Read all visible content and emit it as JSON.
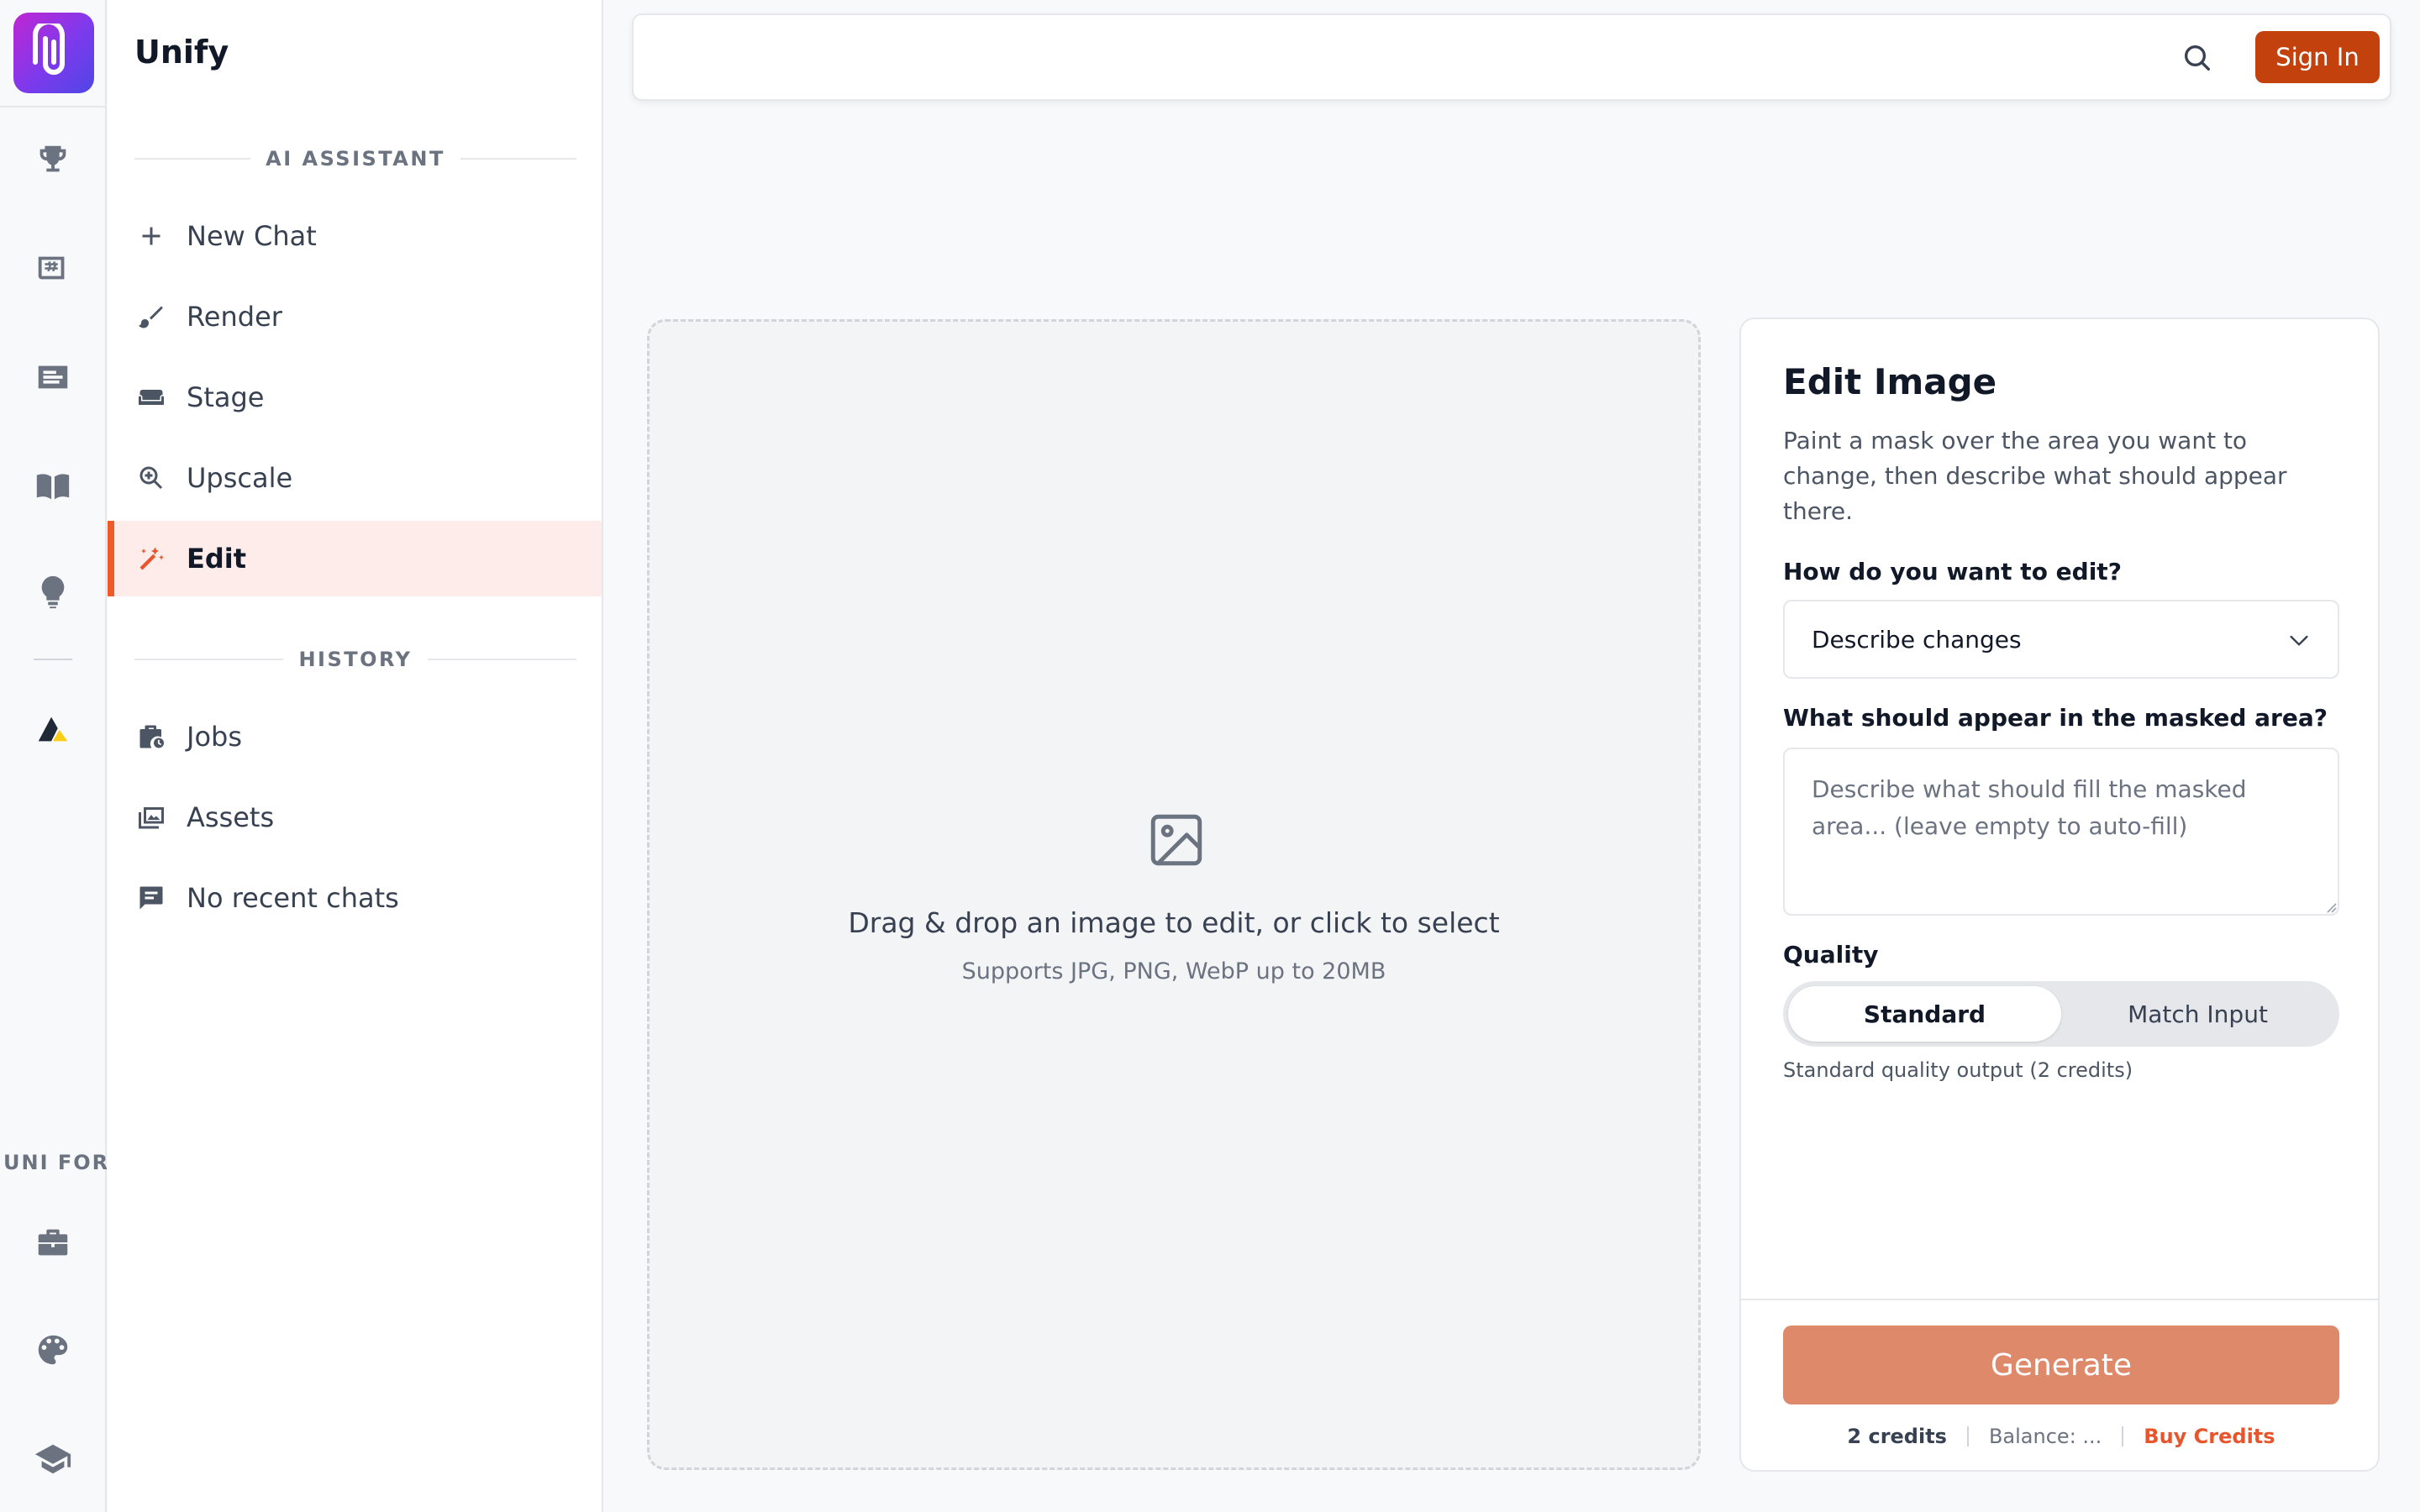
{
  "app": {
    "name": "Unify"
  },
  "rail": {
    "section_label": "UNI FOR",
    "top_icons": [
      "trophy-icon",
      "news-icon",
      "articles-icon",
      "book-icon",
      "lightbulb-icon",
      "brand-mark-icon"
    ],
    "bottom_icons": [
      "briefcase-icon",
      "palette-icon",
      "graduation-cap-icon"
    ]
  },
  "sidebar": {
    "ai_section": "AI ASSISTANT",
    "history_section": "HISTORY",
    "ai_items": [
      {
        "label": "New Chat",
        "icon": "plus-icon"
      },
      {
        "label": "Render",
        "icon": "brush-icon"
      },
      {
        "label": "Stage",
        "icon": "sofa-icon"
      },
      {
        "label": "Upscale",
        "icon": "zoom-icon"
      },
      {
        "label": "Edit",
        "icon": "magic-wand-icon",
        "active": true
      }
    ],
    "history_items": [
      {
        "label": "Jobs",
        "icon": "jobs-icon"
      },
      {
        "label": "Assets",
        "icon": "image-stack-icon"
      },
      {
        "label": "No recent chats",
        "icon": "chat-icon"
      }
    ]
  },
  "topbar": {
    "search_placeholder": "",
    "sign_in": "Sign In"
  },
  "dropzone": {
    "title": "Drag & drop an image to edit, or click to select",
    "subtitle": "Supports JPG, PNG, WebP up to 20MB"
  },
  "editor": {
    "title": "Edit Image",
    "description": "Paint a mask over the area you want to change, then describe what should appear there.",
    "mode_label": "How do you want to edit?",
    "mode_value": "Describe changes",
    "prompt_label": "What should appear in the masked area?",
    "prompt_placeholder": "Describe what should fill the masked area... (leave empty to auto-fill)",
    "prompt_value": "",
    "quality_label": "Quality",
    "quality_options": [
      "Standard",
      "Match Input"
    ],
    "quality_selected": "Standard",
    "quality_note": "Standard quality output (2 credits)",
    "generate": "Generate",
    "credits": "2 credits",
    "balance": "Balance: ...",
    "buy_credits": "Buy Credits"
  },
  "colors": {
    "accent": "#f05a28",
    "sign_in_bg": "#c2410c",
    "generate_bg": "#de8a6a",
    "active_bg": "#fdecea"
  }
}
